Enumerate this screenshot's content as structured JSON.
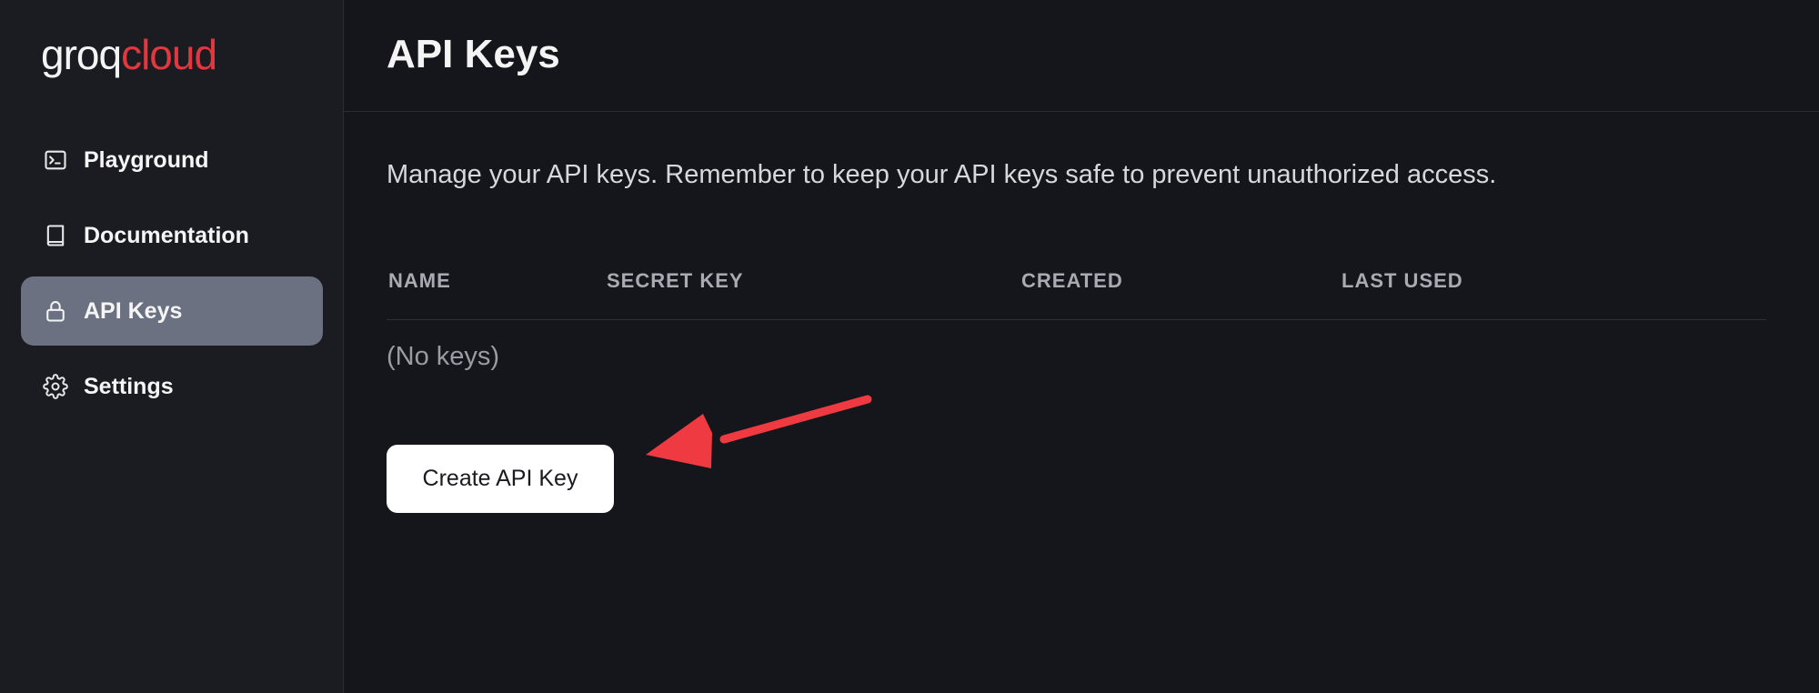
{
  "brand": {
    "logo_primary": "groq",
    "logo_secondary": "cloud",
    "primary_color": "#f4f4f5",
    "accent_color": "#e0383e"
  },
  "sidebar": {
    "items": [
      {
        "label": "Playground",
        "icon": "terminal-icon",
        "active": false
      },
      {
        "label": "Documentation",
        "icon": "book-icon",
        "active": false
      },
      {
        "label": "API Keys",
        "icon": "lock-icon",
        "active": true
      },
      {
        "label": "Settings",
        "icon": "gear-icon",
        "active": false
      }
    ]
  },
  "page": {
    "title": "API Keys",
    "description": "Manage your API keys. Remember to keep your API keys safe to prevent unauthorized access."
  },
  "table": {
    "columns": [
      "NAME",
      "SECRET KEY",
      "CREATED",
      "LAST USED"
    ],
    "empty_text": "(No keys)"
  },
  "actions": {
    "create_label": "Create API Key"
  },
  "annotation": {
    "arrow_color": "#ee3a40"
  }
}
